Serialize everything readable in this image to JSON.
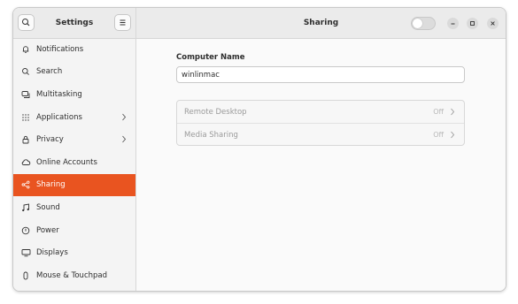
{
  "sidebar": {
    "title": "Settings",
    "items": [
      {
        "label": "Notifications",
        "icon": "bell-icon",
        "has_arrow": false,
        "active": false
      },
      {
        "label": "Search",
        "icon": "search-icon",
        "has_arrow": false,
        "active": false
      },
      {
        "label": "Multitasking",
        "icon": "multitasking-icon",
        "has_arrow": false,
        "active": false
      },
      {
        "label": "Applications",
        "icon": "apps-grid-icon",
        "has_arrow": true,
        "active": false
      },
      {
        "label": "Privacy",
        "icon": "lock-icon",
        "has_arrow": true,
        "active": false
      },
      {
        "label": "Online Accounts",
        "icon": "cloud-icon",
        "has_arrow": false,
        "active": false
      },
      {
        "label": "Sharing",
        "icon": "share-icon",
        "has_arrow": false,
        "active": true
      },
      {
        "label": "Sound",
        "icon": "music-note-icon",
        "has_arrow": false,
        "active": false
      },
      {
        "label": "Power",
        "icon": "power-icon",
        "has_arrow": false,
        "active": false
      },
      {
        "label": "Displays",
        "icon": "display-icon",
        "has_arrow": false,
        "active": false
      },
      {
        "label": "Mouse & Touchpad",
        "icon": "mouse-icon",
        "has_arrow": false,
        "active": false
      }
    ]
  },
  "header": {
    "title": "Sharing",
    "toggle_on": false
  },
  "main": {
    "computer_name_label": "Computer Name",
    "computer_name_value": "winlinmac",
    "rows": [
      {
        "label": "Remote Desktop",
        "state": "Off"
      },
      {
        "label": "Media Sharing",
        "state": "Off"
      }
    ]
  },
  "colors": {
    "accent": "#e95420"
  }
}
